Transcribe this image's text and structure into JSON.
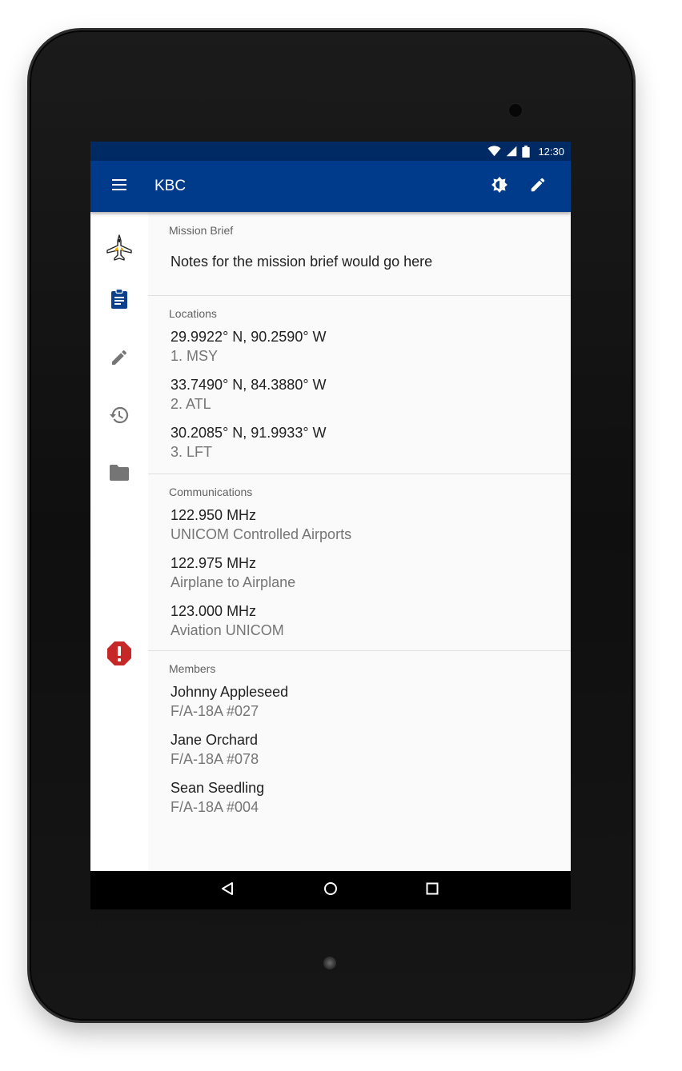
{
  "status_bar": {
    "time": "12:30",
    "icons": [
      "wifi-icon",
      "signal-icon",
      "battery-icon"
    ]
  },
  "app_bar": {
    "title": "KBC",
    "actions": [
      "brightness-icon",
      "edit-icon"
    ]
  },
  "rail": {
    "items": [
      "jet-icon",
      "clipboard-icon",
      "pencil-icon",
      "history-icon",
      "folder-icon",
      "alert-icon"
    ]
  },
  "mission_brief": {
    "label": "Mission Brief",
    "text": "Notes for the mission brief would go here"
  },
  "locations": {
    "label": "Locations",
    "items": [
      {
        "primary": "29.9922° N, 90.2590° W",
        "secondary": "1. MSY"
      },
      {
        "primary": "33.7490° N, 84.3880° W",
        "secondary": "2. ATL"
      },
      {
        "primary": "30.2085° N, 91.9933° W",
        "secondary": "3. LFT"
      }
    ]
  },
  "communications": {
    "label": "Communications",
    "items": [
      {
        "primary": "122.950 MHz",
        "secondary": "UNICOM Controlled Airports"
      },
      {
        "primary": "122.975 MHz",
        "secondary": "Airplane to Airplane"
      },
      {
        "primary": "123.000 MHz",
        "secondary": "Aviation UNICOM"
      }
    ]
  },
  "members": {
    "label": "Members",
    "items": [
      {
        "primary": "Johnny Appleseed",
        "secondary": "F/A-18A #027"
      },
      {
        "primary": "Jane Orchard",
        "secondary": "F/A-18A #078"
      },
      {
        "primary": "Sean Seedling",
        "secondary": "F/A-18A #004"
      }
    ]
  },
  "nav_bar": {
    "buttons": [
      "back-icon",
      "home-icon",
      "recents-icon"
    ]
  },
  "colors": {
    "status_bar": "#002a63",
    "app_bar": "#003a8b",
    "accent_icon": "#0d3f8f",
    "alert": "#c62828"
  }
}
